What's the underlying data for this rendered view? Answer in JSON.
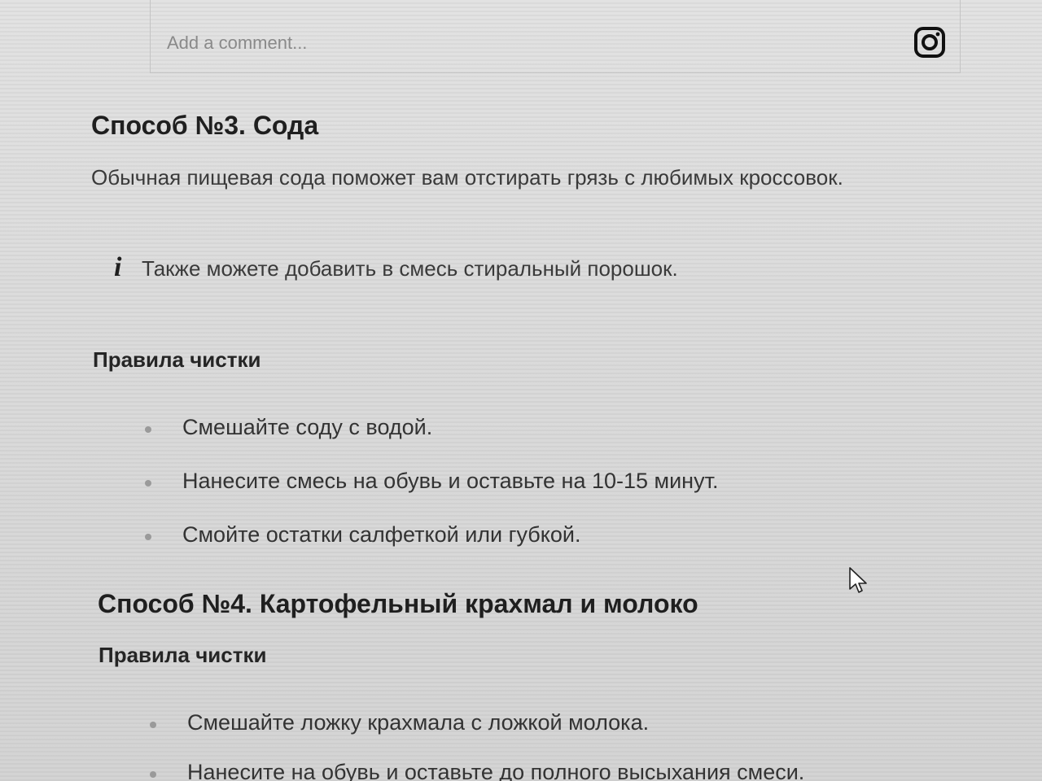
{
  "comment": {
    "placeholder": "Add a comment...",
    "icon": "instagram-icon"
  },
  "section3": {
    "title": "Способ №3. Сода",
    "intro": "Обычная пищевая сода поможет вам отстирать грязь с любимых кроссовок.",
    "info_icon": "i",
    "info_text": "Также можете добавить в смесь стиральный порошок.",
    "rules_title": "Правила чистки",
    "steps": [
      "Смешайте соду с водой.",
      "Нанесите смесь на обувь и оставьте на 10-15 минут.",
      "Смойте остатки салфеткой или губкой."
    ]
  },
  "section4": {
    "title": "Способ №4. Картофельный крахмал и молоко",
    "rules_title": "Правила чистки",
    "steps": [
      "Смешайте ложку крахмала с ложкой молока.",
      "Нанесите на обувь и оставьте до полного высыхания смеси."
    ]
  }
}
